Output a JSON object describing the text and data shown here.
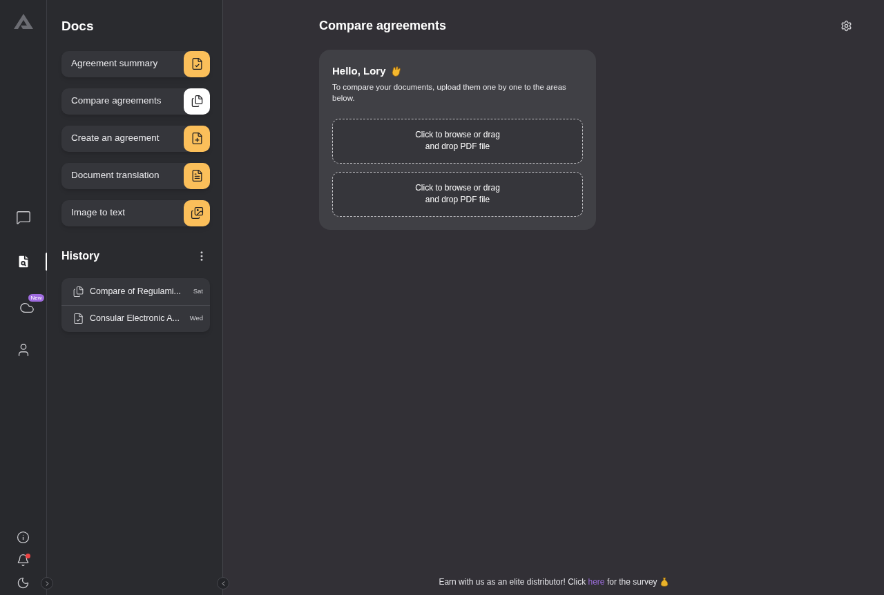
{
  "rail": {
    "items": [
      {
        "kind": "chat",
        "selected": false
      },
      {
        "kind": "docs",
        "selected": true
      },
      {
        "kind": "cloud",
        "selected": false,
        "badge": "New"
      },
      {
        "kind": "user",
        "selected": false
      }
    ],
    "bottom": [
      {
        "kind": "info"
      },
      {
        "kind": "bell",
        "alert": true
      },
      {
        "kind": "moon"
      }
    ]
  },
  "sidebar": {
    "title": "Docs",
    "tools": [
      {
        "label": "Agreement summary",
        "kind": "check",
        "selected": false
      },
      {
        "label": "Compare agreements",
        "kind": "compare",
        "selected": true
      },
      {
        "label": "Create an agreement",
        "kind": "plus",
        "selected": false
      },
      {
        "label": "Document translation",
        "kind": "translate",
        "selected": false
      },
      {
        "label": "Image to text",
        "kind": "image",
        "selected": false
      }
    ],
    "history_title": "History",
    "history": [
      {
        "title": "Compare of Regulami...",
        "day": "Sat",
        "kind": "compare"
      },
      {
        "title": "Consular Electronic A...",
        "day": "Wed",
        "kind": "check"
      }
    ]
  },
  "main": {
    "title": "Compare agreements",
    "card": {
      "greeting": "Hello, Lory",
      "text": "To compare your documents, upload them one by one to the areas below.",
      "dropzones": [
        "Click to browse or drag\nand drop PDF file",
        "Click to browse or drag\nand drop PDF file"
      ]
    },
    "footer": {
      "before": "Earn with us as an elite distributor! Click",
      "link": "here",
      "after": "for the survey"
    }
  }
}
